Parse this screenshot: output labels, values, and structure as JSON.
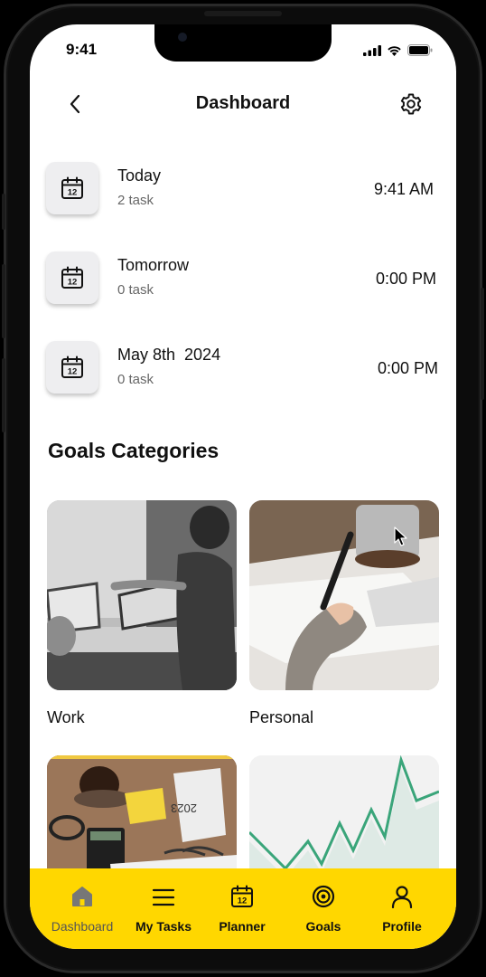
{
  "status_bar": {
    "time": "9:41"
  },
  "header": {
    "title": "Dashboard"
  },
  "schedule": [
    {
      "label": "Today",
      "sub": "2 task",
      "time": "9:41 AM",
      "cal_num": "12"
    },
    {
      "label": "Tomorrow",
      "sub": "0 task",
      "time": "0:00 PM",
      "cal_num": "12"
    },
    {
      "label": "May 8th  2024",
      "sub": "0 task",
      "time": "0:00 PM",
      "cal_num": "12"
    }
  ],
  "goals": {
    "title": "Goals Categories",
    "cards": [
      {
        "label": "Work"
      },
      {
        "label": "Personal"
      },
      {
        "label": "",
        "image_text": "2023"
      },
      {
        "label": ""
      }
    ]
  },
  "tabbar": {
    "items": [
      {
        "label": "Dashboard",
        "icon": "home-icon",
        "active": true
      },
      {
        "label": "My Tasks",
        "icon": "list-icon"
      },
      {
        "label": "Planner",
        "icon": "calendar-icon",
        "cal_num": "12"
      },
      {
        "label": "Goals",
        "icon": "target-icon"
      },
      {
        "label": "Profile",
        "icon": "user-icon"
      }
    ],
    "bg_color": "#FFD700"
  },
  "colors": {
    "accent": "#FFD700",
    "text": "#111111",
    "muted": "#666666"
  }
}
